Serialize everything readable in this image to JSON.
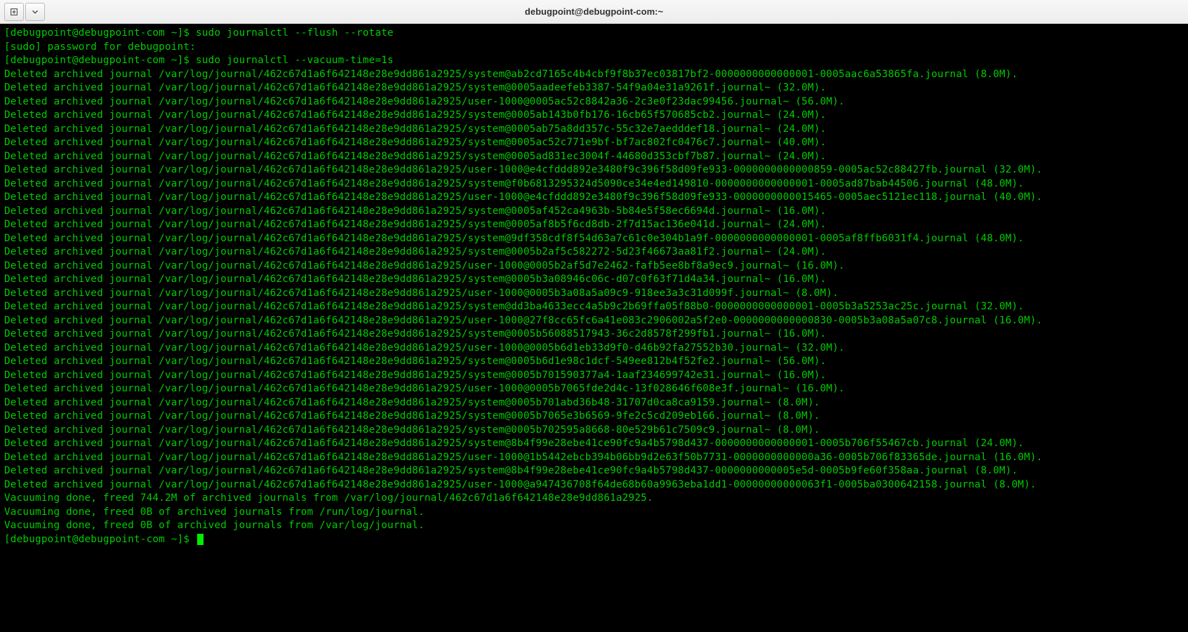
{
  "window": {
    "title": "debugpoint@debugpoint-com:~"
  },
  "terminal": {
    "prompt1": "[debugpoint@debugpoint-com ~]$ ",
    "cmd1": "sudo journalctl --flush --rotate",
    "sudo_line": "[sudo] password for debugpoint:",
    "prompt2": "[debugpoint@debugpoint-com ~]$ ",
    "cmd2": "sudo journalctl --vacuum-time=1s",
    "deleted_lines": [
      "Deleted archived journal /var/log/journal/462c67d1a6f642148e28e9dd861a2925/system@ab2cd7165c4b4cbf9f8b37ec03817bf2-0000000000000001-0005aac6a53865fa.journal (8.0M).",
      "Deleted archived journal /var/log/journal/462c67d1a6f642148e28e9dd861a2925/system@0005aadeefeb3387-54f9a04e31a9261f.journal~ (32.0M).",
      "Deleted archived journal /var/log/journal/462c67d1a6f642148e28e9dd861a2925/user-1000@0005ac52c8842a36-2c3e0f23dac99456.journal~ (56.0M).",
      "Deleted archived journal /var/log/journal/462c67d1a6f642148e28e9dd861a2925/system@0005ab143b0fb176-16cb65f570685cb2.journal~ (24.0M).",
      "Deleted archived journal /var/log/journal/462c67d1a6f642148e28e9dd861a2925/system@0005ab75a8dd357c-55c32e7aedddef18.journal~ (24.0M).",
      "Deleted archived journal /var/log/journal/462c67d1a6f642148e28e9dd861a2925/system@0005ac52c771e9bf-bf7ac802fc0476c7.journal~ (40.0M).",
      "Deleted archived journal /var/log/journal/462c67d1a6f642148e28e9dd861a2925/system@0005ad831ec3004f-44680d353cbf7b87.journal~ (24.0M).",
      "Deleted archived journal /var/log/journal/462c67d1a6f642148e28e9dd861a2925/user-1000@e4cfddd892e3480f9c396f58d09fe933-0000000000000859-0005ac52c88427fb.journal (32.0M).",
      "Deleted archived journal /var/log/journal/462c67d1a6f642148e28e9dd861a2925/system@f0b6813295324d5090ce34e4ed149810-0000000000000001-0005ad87bab44506.journal (48.0M).",
      "Deleted archived journal /var/log/journal/462c67d1a6f642148e28e9dd861a2925/user-1000@e4cfddd892e3480f9c396f58d09fe933-0000000000015465-0005aec5121ec118.journal (40.0M).",
      "Deleted archived journal /var/log/journal/462c67d1a6f642148e28e9dd861a2925/system@0005af452ca4963b-5b84e5f58ec6694d.journal~ (16.0M).",
      "Deleted archived journal /var/log/journal/462c67d1a6f642148e28e9dd861a2925/system@0005af8b5f6cd8db-2f7d15ac136e041d.journal~ (24.0M).",
      "Deleted archived journal /var/log/journal/462c67d1a6f642148e28e9dd861a2925/system@9df358cdf8f54d63a7c61c0e304b1a9f-0000000000000001-0005af8ffb6031f4.journal (48.0M).",
      "Deleted archived journal /var/log/journal/462c67d1a6f642148e28e9dd861a2925/system@0005b2af5c582272-5d23f46673aa81f2.journal~ (24.0M).",
      "Deleted archived journal /var/log/journal/462c67d1a6f642148e28e9dd861a2925/user-1000@0005b2af5d7e2462-fafb5ee8bf8a9ec9.journal~ (16.0M).",
      "Deleted archived journal /var/log/journal/462c67d1a6f642148e28e9dd861a2925/system@0005b3a08946c06c-d07c0f63f71d4a34.journal~ (16.0M).",
      "Deleted archived journal /var/log/journal/462c67d1a6f642148e28e9dd861a2925/user-1000@0005b3a08a5a09c9-918ee3a3c31d099f.journal~ (8.0M).",
      "Deleted archived journal /var/log/journal/462c67d1a6f642148e28e9dd861a2925/system@dd3ba4633ecc4a5b9c2b69ffa05f88b0-0000000000000001-0005b3a5253ac25c.journal (32.0M).",
      "Deleted archived journal /var/log/journal/462c67d1a6f642148e28e9dd861a2925/user-1000@27f8cc65fc6a41e083c2906002a5f2e0-0000000000000830-0005b3a08a5a07c8.journal (16.0M).",
      "Deleted archived journal /var/log/journal/462c67d1a6f642148e28e9dd861a2925/system@0005b56088517943-36c2d8578f299fb1.journal~ (16.0M).",
      "Deleted archived journal /var/log/journal/462c67d1a6f642148e28e9dd861a2925/user-1000@0005b6d1eb33d9f0-d46b92fa27552b30.journal~ (32.0M).",
      "Deleted archived journal /var/log/journal/462c67d1a6f642148e28e9dd861a2925/system@0005b6d1e98c1dcf-549ee812b4f52fe2.journal~ (56.0M).",
      "Deleted archived journal /var/log/journal/462c67d1a6f642148e28e9dd861a2925/system@0005b701590377a4-1aaf234699742e31.journal~ (16.0M).",
      "Deleted archived journal /var/log/journal/462c67d1a6f642148e28e9dd861a2925/user-1000@0005b7065fde2d4c-13f028646f608e3f.journal~ (16.0M).",
      "Deleted archived journal /var/log/journal/462c67d1a6f642148e28e9dd861a2925/system@0005b701abd36b48-31707d0ca8ca9159.journal~ (8.0M).",
      "Deleted archived journal /var/log/journal/462c67d1a6f642148e28e9dd861a2925/system@0005b7065e3b6569-9fe2c5cd209eb166.journal~ (8.0M).",
      "Deleted archived journal /var/log/journal/462c67d1a6f642148e28e9dd861a2925/system@0005b702595a8668-80e529b61c7509c9.journal~ (8.0M).",
      "Deleted archived journal /var/log/journal/462c67d1a6f642148e28e9dd861a2925/system@8b4f99e28ebe41ce90fc9a4b5798d437-0000000000000001-0005b706f55467cb.journal (24.0M).",
      "Deleted archived journal /var/log/journal/462c67d1a6f642148e28e9dd861a2925/user-1000@1b5442ebcb394b06bb9d2e63f50b7731-0000000000000a36-0005b706f83365de.journal (16.0M).",
      "Deleted archived journal /var/log/journal/462c67d1a6f642148e28e9dd861a2925/system@8b4f99e28ebe41ce90fc9a4b5798d437-0000000000005e5d-0005b9fe60f358aa.journal (8.0M).",
      "Deleted archived journal /var/log/journal/462c67d1a6f642148e28e9dd861a2925/user-1000@a947436708f64de68b60a9963eba1dd1-00000000000063f1-0005ba0300642158.journal (8.0M)."
    ],
    "vacuum_lines": [
      "Vacuuming done, freed 744.2M of archived journals from /var/log/journal/462c67d1a6f642148e28e9dd861a2925.",
      "Vacuuming done, freed 0B of archived journals from /run/log/journal.",
      "Vacuuming done, freed 0B of archived journals from /var/log/journal."
    ],
    "prompt3": "[debugpoint@debugpoint-com ~]$ "
  }
}
